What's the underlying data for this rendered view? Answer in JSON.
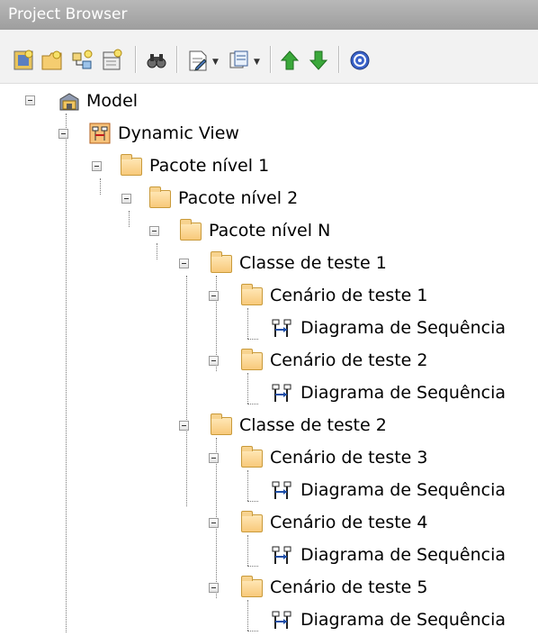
{
  "panel": {
    "title": "Project Browser"
  },
  "toolbar": {
    "icons": [
      "new-model-icon",
      "new-package-icon",
      "new-diagram-icon",
      "new-element-icon",
      "find-icon",
      "document-icon",
      "view-icon",
      "move-up-icon",
      "move-down-icon",
      "help-icon"
    ]
  },
  "tree": {
    "model": "Model",
    "dynamic_view": "Dynamic View",
    "pkg1": "Pacote nível 1",
    "pkg2": "Pacote nível 2",
    "pkgN": "Pacote nível N",
    "class1": "Classe de teste 1",
    "scen1": "Cenário de teste 1",
    "diag1": "Diagrama de Sequência",
    "scen2": "Cenário de teste 2",
    "diag2": "Diagrama de Sequência",
    "class2": "Classe de teste 2",
    "scen3": "Cenário de teste 3",
    "diag3": "Diagrama de Sequência",
    "scen4": "Cenário de teste 4",
    "diag4": "Diagrama de Sequência",
    "scen5": "Cenário de teste 5",
    "diag5": "Diagrama de Sequência"
  },
  "colors": {
    "title_bar": "#a8a8a8",
    "folder": "#f8c97a",
    "arrow_green": "#3aa83a"
  }
}
